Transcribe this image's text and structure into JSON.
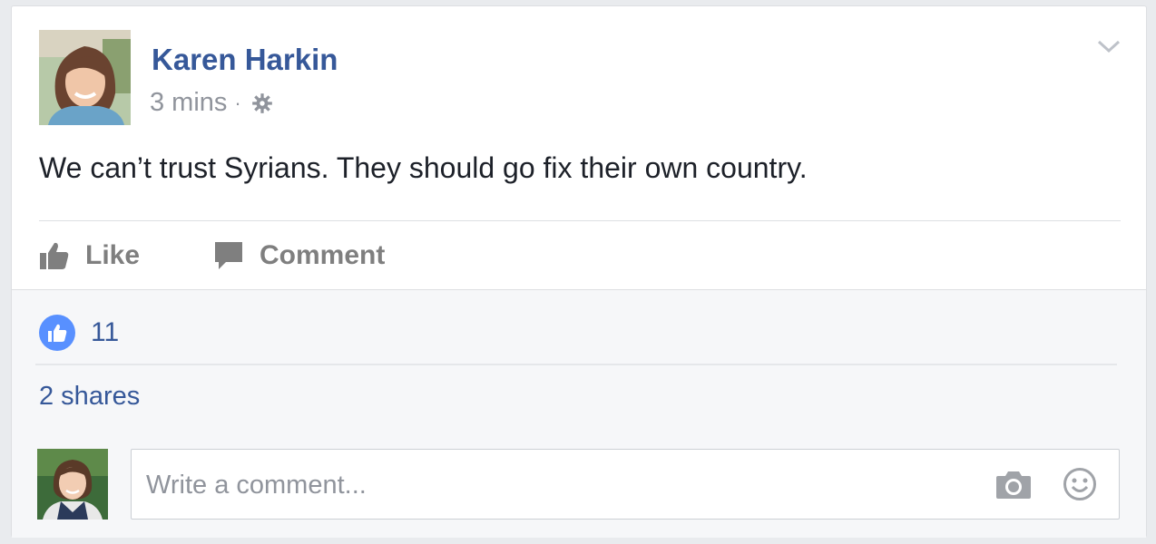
{
  "post": {
    "author": "Karen Harkin",
    "time": "3 mins",
    "separator": "·",
    "privacy_icon": "gear-icon",
    "text": "We can’t trust Syrians. They should go fix their own country."
  },
  "actions": {
    "like_label": "Like",
    "comment_label": "Comment"
  },
  "reactions": {
    "like_count": "11",
    "shares": "2 shares"
  },
  "comment_composer": {
    "placeholder": "Write a comment...",
    "icons": [
      "camera-icon",
      "smiley-icon"
    ]
  },
  "colors": {
    "link_blue": "#365899",
    "like_blue": "#5890ff",
    "muted": "#90949c",
    "background": "#e9ebee"
  }
}
